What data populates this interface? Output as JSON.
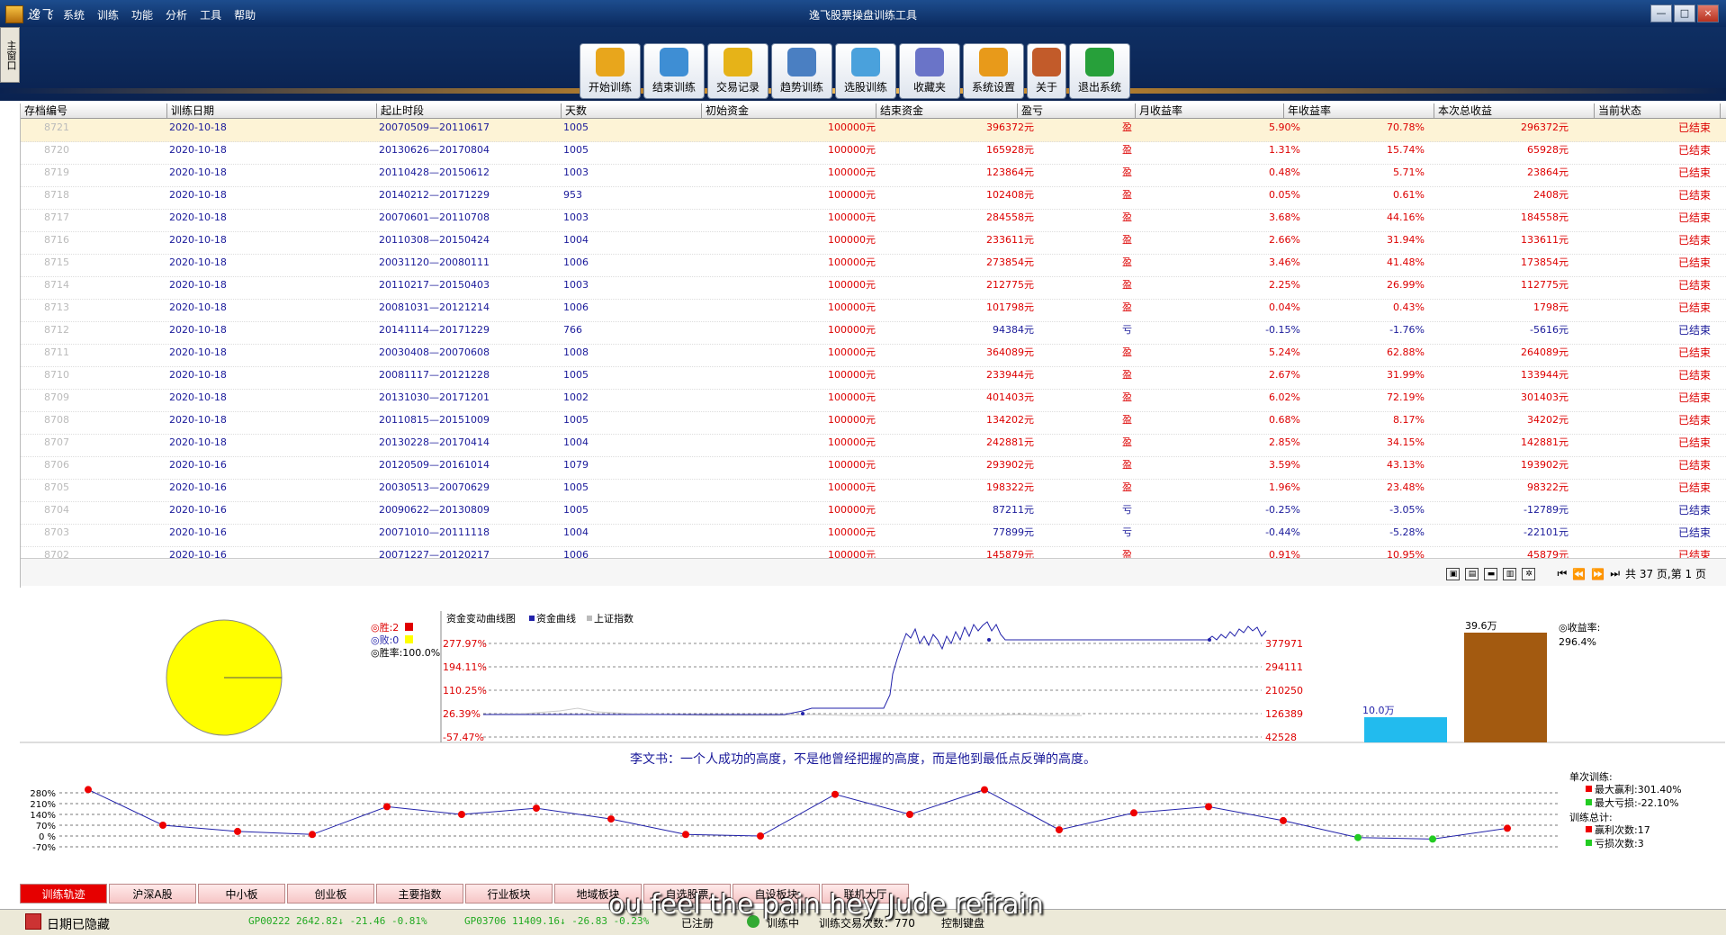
{
  "app": {
    "brand": "逸飞",
    "window_title": "逸飞股票操盘训练工具",
    "side_tab": "主窗口"
  },
  "menu": [
    "系统",
    "训练",
    "功能",
    "分析",
    "工具",
    "帮助"
  ],
  "window_controls": {
    "minimize": "—",
    "maximize": "□",
    "close": "×"
  },
  "toolbar": [
    {
      "label": "开始训练",
      "icon": "coins-icon",
      "color": "#e8a61c"
    },
    {
      "label": "结束训练",
      "icon": "easel-icon",
      "color": "#3e8ed4"
    },
    {
      "label": "交易记录",
      "icon": "box-icon",
      "color": "#e6b318"
    },
    {
      "label": "趋势训练",
      "icon": "truck-icon",
      "color": "#4a7fc2"
    },
    {
      "label": "选股训练",
      "icon": "globe-icon",
      "color": "#4aa1dc"
    },
    {
      "label": "收藏夹",
      "icon": "folder-icon",
      "color": "#6a74c8"
    },
    {
      "label": "系统设置",
      "icon": "gear-icon",
      "color": "#e89a1a"
    },
    {
      "label": "关于",
      "icon": "people-icon",
      "color": "#c25b2a"
    },
    {
      "label": "退出系统",
      "icon": "arrow-right-icon",
      "color": "#27a03a"
    }
  ],
  "grid": {
    "columns": [
      "存档编号",
      "训练日期",
      "起止时段",
      "天数",
      "初始资金",
      "结束资金",
      "盈亏",
      "月收益率",
      "年收益率",
      "本次总收益",
      "当前状态"
    ],
    "rows": [
      [
        "8721",
        "2020-10-18",
        "20070509—20110617",
        "1005",
        "100000元",
        "396372元",
        "盈",
        "5.90%",
        "70.78%",
        "296372元",
        "已结束"
      ],
      [
        "8720",
        "2020-10-18",
        "20130626—20170804",
        "1005",
        "100000元",
        "165928元",
        "盈",
        "1.31%",
        "15.74%",
        "65928元",
        "已结束"
      ],
      [
        "8719",
        "2020-10-18",
        "20110428—20150612",
        "1003",
        "100000元",
        "123864元",
        "盈",
        "0.48%",
        "5.71%",
        "23864元",
        "已结束"
      ],
      [
        "8718",
        "2020-10-18",
        "20140212—20171229",
        "953",
        "100000元",
        "102408元",
        "盈",
        "0.05%",
        "0.61%",
        "2408元",
        "已结束"
      ],
      [
        "8717",
        "2020-10-18",
        "20070601—20110708",
        "1003",
        "100000元",
        "284558元",
        "盈",
        "3.68%",
        "44.16%",
        "184558元",
        "已结束"
      ],
      [
        "8716",
        "2020-10-18",
        "20110308—20150424",
        "1004",
        "100000元",
        "233611元",
        "盈",
        "2.66%",
        "31.94%",
        "133611元",
        "已结束"
      ],
      [
        "8715",
        "2020-10-18",
        "20031120—20080111",
        "1006",
        "100000元",
        "273854元",
        "盈",
        "3.46%",
        "41.48%",
        "173854元",
        "已结束"
      ],
      [
        "8714",
        "2020-10-18",
        "20110217—20150403",
        "1003",
        "100000元",
        "212775元",
        "盈",
        "2.25%",
        "26.99%",
        "112775元",
        "已结束"
      ],
      [
        "8713",
        "2020-10-18",
        "20081031—20121214",
        "1006",
        "100000元",
        "101798元",
        "盈",
        "0.04%",
        "0.43%",
        "1798元",
        "已结束"
      ],
      [
        "8712",
        "2020-10-18",
        "20141114—20171229",
        "766",
        "100000元",
        "94384元",
        "亏",
        "-0.15%",
        "-1.76%",
        "-5616元",
        "已结束"
      ],
      [
        "8711",
        "2020-10-18",
        "20030408—20070608",
        "1008",
        "100000元",
        "364089元",
        "盈",
        "5.24%",
        "62.88%",
        "264089元",
        "已结束"
      ],
      [
        "8710",
        "2020-10-18",
        "20081117—20121228",
        "1005",
        "100000元",
        "233944元",
        "盈",
        "2.67%",
        "31.99%",
        "133944元",
        "已结束"
      ],
      [
        "8709",
        "2020-10-18",
        "20131030—20171201",
        "1002",
        "100000元",
        "401403元",
        "盈",
        "6.02%",
        "72.19%",
        "301403元",
        "已结束"
      ],
      [
        "8708",
        "2020-10-18",
        "20110815—20151009",
        "1005",
        "100000元",
        "134202元",
        "盈",
        "0.68%",
        "8.17%",
        "34202元",
        "已结束"
      ],
      [
        "8707",
        "2020-10-18",
        "20130228—20170414",
        "1004",
        "100000元",
        "242881元",
        "盈",
        "2.85%",
        "34.15%",
        "142881元",
        "已结束"
      ],
      [
        "8706",
        "2020-10-16",
        "20120509—20161014",
        "1079",
        "100000元",
        "293902元",
        "盈",
        "3.59%",
        "43.13%",
        "193902元",
        "已结束"
      ],
      [
        "8705",
        "2020-10-16",
        "20030513—20070629",
        "1005",
        "100000元",
        "198322元",
        "盈",
        "1.96%",
        "23.48%",
        "98322元",
        "已结束"
      ],
      [
        "8704",
        "2020-10-16",
        "20090622—20130809",
        "1005",
        "100000元",
        "87211元",
        "亏",
        "-0.25%",
        "-3.05%",
        "-12789元",
        "已结束"
      ],
      [
        "8703",
        "2020-10-16",
        "20071010—20111118",
        "1004",
        "100000元",
        "77899元",
        "亏",
        "-0.44%",
        "-5.28%",
        "-22101元",
        "已结束"
      ],
      [
        "8702",
        "2020-10-16",
        "20071227—20120217",
        "1006",
        "100000元",
        "145879元",
        "盈",
        "0.91%",
        "10.95%",
        "45879元",
        "已结束"
      ]
    ],
    "pager": {
      "total_label": "共 37 页,第 1 页"
    }
  },
  "pie": {
    "win_label": "◎胜:2",
    "lose_label": "◎败:0",
    "rate_label": "◎胜率:100.0%",
    "win_color": "#e00000",
    "lose_color": "#ffff00"
  },
  "fund_chart": {
    "legend_title": "资金变动曲线图",
    "legend_fund": "资金曲线",
    "legend_index": "上证指数",
    "left_ticks": [
      "277.97%",
      "194.11%",
      "110.25%",
      "26.39%",
      "-57.47%"
    ],
    "right_ticks": [
      "377971",
      "294111",
      "210250",
      "126389",
      "42528"
    ]
  },
  "bars": {
    "small_label": "10.0万",
    "big_label": "39.6万",
    "rate_title": "◎收益率:",
    "rate_value": "296.4%"
  },
  "quote": "李文书：一个人成功的高度，不是他曾经把握的高度，而是他到最低点反弹的高度。",
  "track_chart": {
    "y_ticks": [
      "280%",
      "210%",
      "140%",
      "70%",
      "0 %",
      "-70%"
    ],
    "values": [
      301,
      70,
      30,
      10,
      190,
      140,
      180,
      110,
      10,
      0,
      270,
      140,
      300,
      40,
      150,
      190,
      100,
      -10,
      -20,
      50
    ],
    "stats": {
      "single_title": "单次训练:",
      "max_gain": "最大赢利:301.40%",
      "max_loss": "最大亏损:-22.10%",
      "total_title": "训练总计:",
      "win_count": "赢利次数:17",
      "loss_count": "亏损次数:3"
    }
  },
  "tabs": [
    "训练轨迹",
    "沪深A股",
    "中小板",
    "创业板",
    "主要指数",
    "行业板块",
    "地域板块",
    "自选股票",
    "自设板块",
    "联机大厅"
  ],
  "status": {
    "date_hidden": "日期已隐藏",
    "ticker1": "GP00222 2642.82↓ -21.46 -0.81%",
    "ticker2": "GP03706 11409.16↓ -26.83 -0.23%",
    "registered": "已注册",
    "training": "训练中",
    "trade_count": "训练交易次数：770",
    "keyboard": "控制键盘"
  },
  "subtitle": "ou feel the pain hey Jude refrain"
}
